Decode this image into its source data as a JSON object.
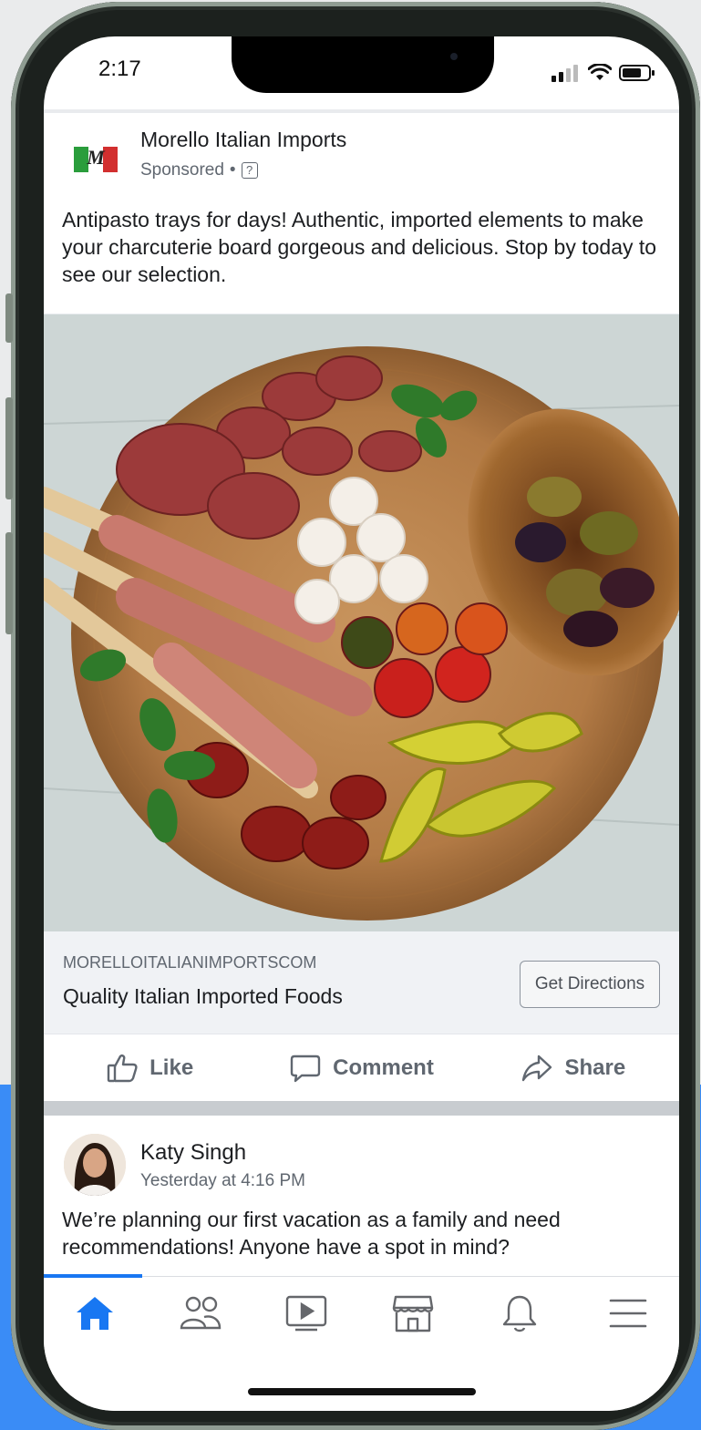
{
  "status_bar": {
    "time": "2:17"
  },
  "ad_post": {
    "page_name": "Morello Italian Imports",
    "logo_letter": "M",
    "sponsored_label": "Sponsored",
    "separator": "•",
    "info_glyph": "?",
    "text": "Antipasto trays for days!  Authentic, imported elements to make your charcuterie board gorgeous and delicious. Stop by today to see our selection.",
    "image_alt": "Antipasto board",
    "link": {
      "domain": "MORELLOITALIANIMPORTSCOM",
      "title": "Quality Italian Imported Foods",
      "cta_label": "Get Directions"
    }
  },
  "actions": {
    "like": "Like",
    "comment": "Comment",
    "share": "Share"
  },
  "friend_post": {
    "author": "Katy Singh",
    "timestamp": "Yesterday at 4:16 PM",
    "text": "We’re planning our first vacation as a family and need recommendations! Anyone have a spot in mind?"
  },
  "tabbar": {
    "tabs": [
      {
        "icon": "home-icon",
        "active": true
      },
      {
        "icon": "friends-icon",
        "active": false
      },
      {
        "icon": "watch-icon",
        "active": false
      },
      {
        "icon": "marketplace-icon",
        "active": false
      },
      {
        "icon": "notifications-icon",
        "active": false
      },
      {
        "icon": "menu-icon",
        "active": false
      }
    ]
  },
  "colors": {
    "accent": "#1877f2",
    "background_blue": "#3a8cf6",
    "phone_frame": "#1c211e"
  }
}
